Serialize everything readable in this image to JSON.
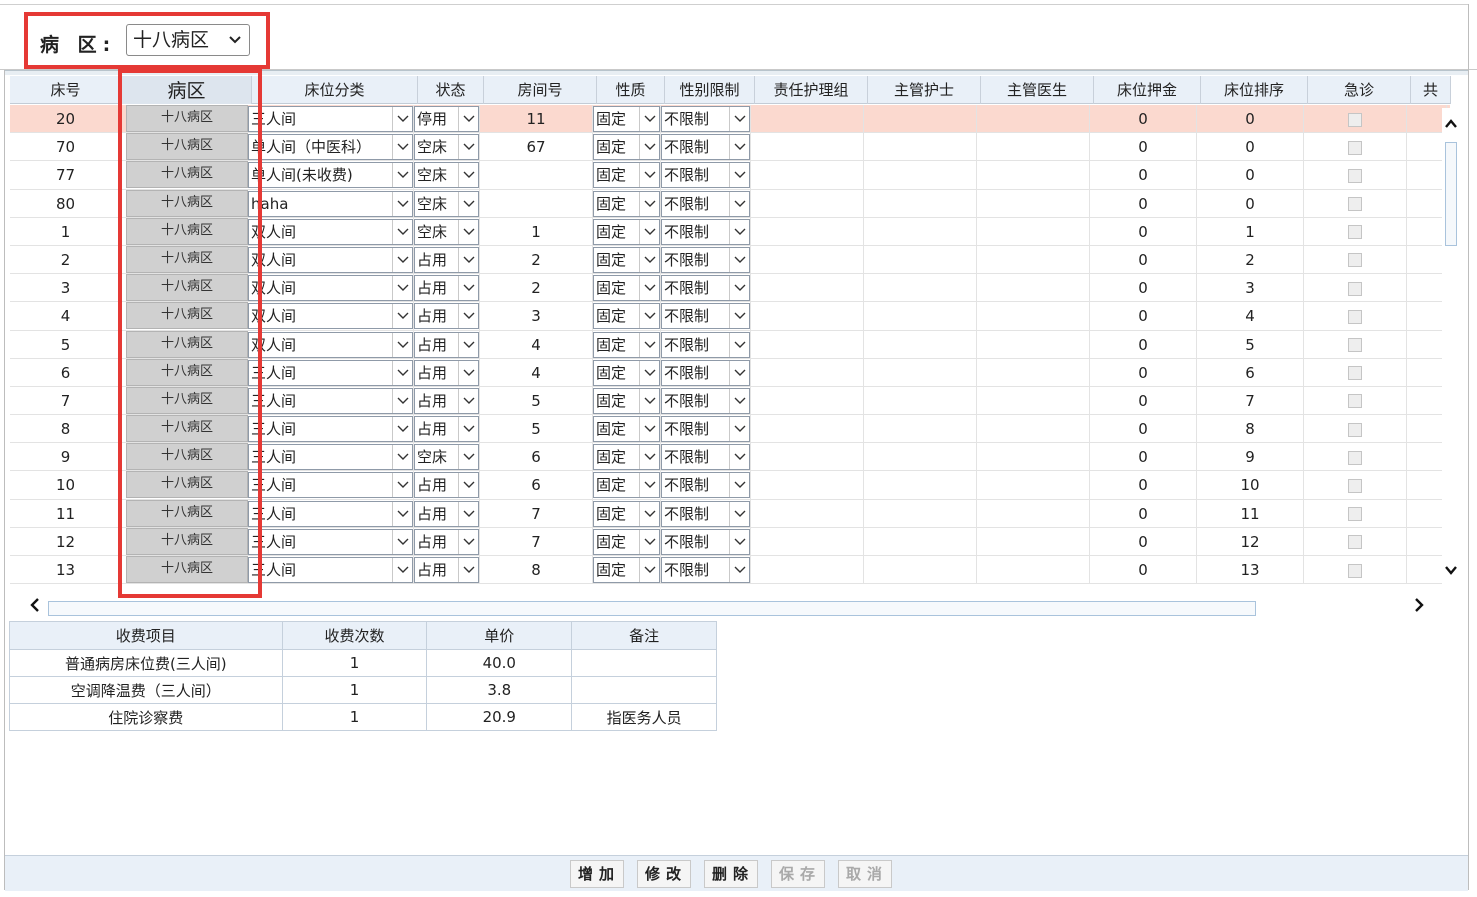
{
  "filter": {
    "label": "病  区:",
    "ward_value": "十八病区"
  },
  "grid": {
    "columns": [
      "床号",
      "病区",
      "床位分类",
      "状态",
      "房间号",
      "性质",
      "性别限制",
      "责任护理组",
      "主管护士",
      "主管医生",
      "床位押金",
      "床位排序",
      "急诊",
      "共"
    ],
    "rows": [
      {
        "bed": "20",
        "ward": "十八病区",
        "category": "三人间",
        "status": "停用",
        "room": "11",
        "nature": "固定",
        "gender": "不限制",
        "nurse_group": "",
        "nurse": "",
        "doctor": "",
        "deposit": "0",
        "order": "0",
        "selected": true
      },
      {
        "bed": "70",
        "ward": "十八病区",
        "category": "单人间（中医科）",
        "status": "空床",
        "room": "67",
        "nature": "固定",
        "gender": "不限制",
        "nurse_group": "",
        "nurse": "",
        "doctor": "",
        "deposit": "0",
        "order": "0"
      },
      {
        "bed": "77",
        "ward": "十八病区",
        "category": "单人间(未收费)",
        "status": "空床",
        "room": "",
        "nature": "固定",
        "gender": "不限制",
        "nurse_group": "",
        "nurse": "",
        "doctor": "",
        "deposit": "0",
        "order": "0"
      },
      {
        "bed": "80",
        "ward": "十八病区",
        "category": "haha",
        "status": "空床",
        "room": "",
        "nature": "固定",
        "gender": "不限制",
        "nurse_group": "",
        "nurse": "",
        "doctor": "",
        "deposit": "0",
        "order": "0"
      },
      {
        "bed": "1",
        "ward": "十八病区",
        "category": "双人间",
        "status": "空床",
        "room": "1",
        "nature": "固定",
        "gender": "不限制",
        "nurse_group": "",
        "nurse": "",
        "doctor": "",
        "deposit": "0",
        "order": "1"
      },
      {
        "bed": "2",
        "ward": "十八病区",
        "category": "双人间",
        "status": "占用",
        "room": "2",
        "nature": "固定",
        "gender": "不限制",
        "nurse_group": "",
        "nurse": "",
        "doctor": "",
        "deposit": "0",
        "order": "2"
      },
      {
        "bed": "3",
        "ward": "十八病区",
        "category": "双人间",
        "status": "占用",
        "room": "2",
        "nature": "固定",
        "gender": "不限制",
        "nurse_group": "",
        "nurse": "",
        "doctor": "",
        "deposit": "0",
        "order": "3"
      },
      {
        "bed": "4",
        "ward": "十八病区",
        "category": "双人间",
        "status": "占用",
        "room": "3",
        "nature": "固定",
        "gender": "不限制",
        "nurse_group": "",
        "nurse": "",
        "doctor": "",
        "deposit": "0",
        "order": "4"
      },
      {
        "bed": "5",
        "ward": "十八病区",
        "category": "双人间",
        "status": "占用",
        "room": "4",
        "nature": "固定",
        "gender": "不限制",
        "nurse_group": "",
        "nurse": "",
        "doctor": "",
        "deposit": "0",
        "order": "5"
      },
      {
        "bed": "6",
        "ward": "十八病区",
        "category": "三人间",
        "status": "占用",
        "room": "4",
        "nature": "固定",
        "gender": "不限制",
        "nurse_group": "",
        "nurse": "",
        "doctor": "",
        "deposit": "0",
        "order": "6"
      },
      {
        "bed": "7",
        "ward": "十八病区",
        "category": "三人间",
        "status": "占用",
        "room": "5",
        "nature": "固定",
        "gender": "不限制",
        "nurse_group": "",
        "nurse": "",
        "doctor": "",
        "deposit": "0",
        "order": "7"
      },
      {
        "bed": "8",
        "ward": "十八病区",
        "category": "三人间",
        "status": "占用",
        "room": "5",
        "nature": "固定",
        "gender": "不限制",
        "nurse_group": "",
        "nurse": "",
        "doctor": "",
        "deposit": "0",
        "order": "8"
      },
      {
        "bed": "9",
        "ward": "十八病区",
        "category": "三人间",
        "status": "空床",
        "room": "6",
        "nature": "固定",
        "gender": "不限制",
        "nurse_group": "",
        "nurse": "",
        "doctor": "",
        "deposit": "0",
        "order": "9"
      },
      {
        "bed": "10",
        "ward": "十八病区",
        "category": "三人间",
        "status": "占用",
        "room": "6",
        "nature": "固定",
        "gender": "不限制",
        "nurse_group": "",
        "nurse": "",
        "doctor": "",
        "deposit": "0",
        "order": "10"
      },
      {
        "bed": "11",
        "ward": "十八病区",
        "category": "三人间",
        "status": "占用",
        "room": "7",
        "nature": "固定",
        "gender": "不限制",
        "nurse_group": "",
        "nurse": "",
        "doctor": "",
        "deposit": "0",
        "order": "11"
      },
      {
        "bed": "12",
        "ward": "十八病区",
        "category": "三人间",
        "status": "占用",
        "room": "7",
        "nature": "固定",
        "gender": "不限制",
        "nurse_group": "",
        "nurse": "",
        "doctor": "",
        "deposit": "0",
        "order": "12"
      },
      {
        "bed": "13",
        "ward": "十八病区",
        "category": "三人间",
        "status": "占用",
        "room": "8",
        "nature": "固定",
        "gender": "不限制",
        "nurse_group": "",
        "nurse": "",
        "doctor": "",
        "deposit": "0",
        "order": "13"
      }
    ]
  },
  "fees": {
    "columns": [
      "收费项目",
      "收费次数",
      "单价",
      "备注"
    ],
    "rows": [
      [
        "普通病房床位费(三人间)",
        "1",
        "40.0",
        ""
      ],
      [
        "空调降温费（三人间）",
        "1",
        "3.8",
        ""
      ],
      [
        "住院诊察费",
        "1",
        "20.9",
        "指医务人员"
      ]
    ]
  },
  "buttons": {
    "add": "增加",
    "edit": "修改",
    "delete": "删除",
    "save": "保存",
    "cancel": "取消"
  },
  "colors": {
    "highlight": "#e53935",
    "selected_row": "#fbd9cf",
    "header_bg": "#e9f0f8"
  }
}
